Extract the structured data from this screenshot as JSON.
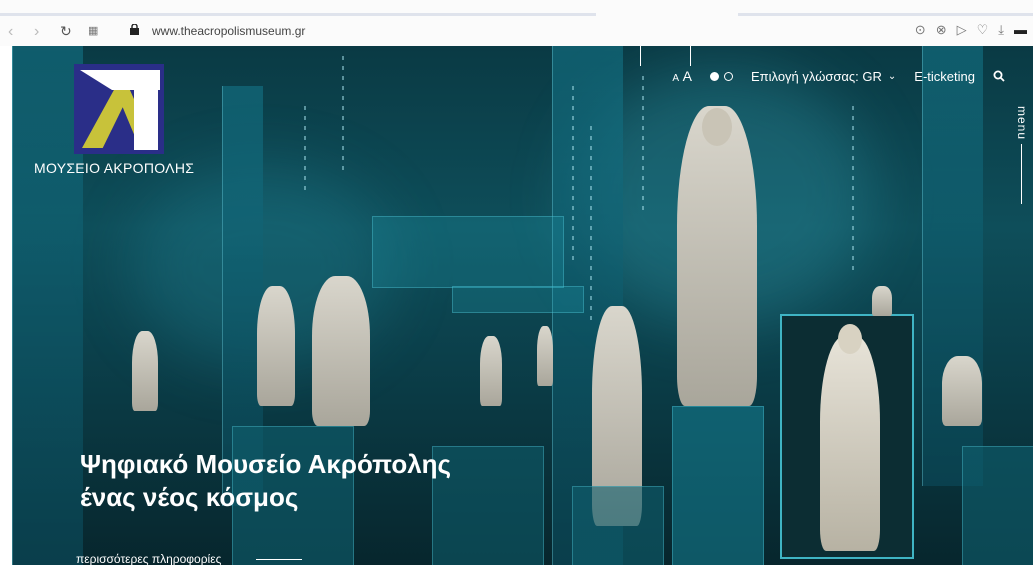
{
  "browser": {
    "url": "www.theacropolismuseum.gr",
    "icons": [
      "back-icon",
      "forward-icon",
      "reload-icon",
      "apps-icon",
      "lock-icon",
      "camera-icon",
      "close-circle-icon",
      "send-icon",
      "heart-icon",
      "download-icon",
      "battery-icon"
    ]
  },
  "site": {
    "logo_text": "ΜΟΥΣΕΙΟ ΑΚΡΟΠΟΛΗΣ",
    "font_small": "A",
    "font_large": "A",
    "language_label": "Επιλογή γλώσσας: GR",
    "eticketing": "E-ticketing",
    "menu": "menu",
    "hero_line1": "Ψηφιακό Μουσείο Ακρόπολης",
    "hero_line2": "ένας νέος κόσμος",
    "more_info": "περισσότερες πληροφορίες"
  },
  "colors": {
    "accent": "#2a2e88",
    "logo_yellow": "#c8c23a",
    "teal": "#0e4e5a"
  }
}
